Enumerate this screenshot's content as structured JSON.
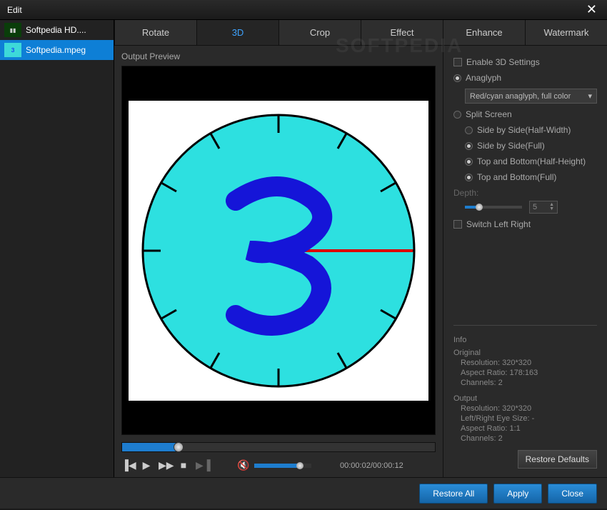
{
  "title": "Edit",
  "sidebar": {
    "files": [
      {
        "name": "Softpedia HD...."
      },
      {
        "name": "Softpedia.mpeg"
      }
    ]
  },
  "tabs": [
    "Rotate",
    "3D",
    "Crop",
    "Effect",
    "Enhance",
    "Watermark"
  ],
  "preview_label": "Output Preview",
  "settings": {
    "enable_3d": "Enable 3D Settings",
    "anaglyph": "Anaglyph",
    "anaglyph_mode": "Red/cyan anaglyph, full color",
    "split_screen": "Split Screen",
    "split_opts": [
      "Side by Side(Half-Width)",
      "Side by Side(Full)",
      "Top and Bottom(Half-Height)",
      "Top and Bottom(Full)"
    ],
    "depth_label": "Depth:",
    "depth_value": "5",
    "switch_lr": "Switch Left Right"
  },
  "info": {
    "header": "Info",
    "original_label": "Original",
    "original": {
      "resolution": "Resolution: 320*320",
      "aspect": "Aspect Ratio: 178:163",
      "channels": "Channels: 2"
    },
    "output_label": "Output",
    "output": {
      "resolution": "Resolution: 320*320",
      "eyesize": "Left/Right Eye Size: -",
      "aspect": "Aspect Ratio: 1:1",
      "channels": "Channels: 2"
    }
  },
  "restore_defaults": "Restore Defaults",
  "time": "00:00:02/00:00:12",
  "footer": {
    "restore_all": "Restore All",
    "apply": "Apply",
    "close": "Close"
  },
  "watermark_text": "SOFTPEDIA"
}
